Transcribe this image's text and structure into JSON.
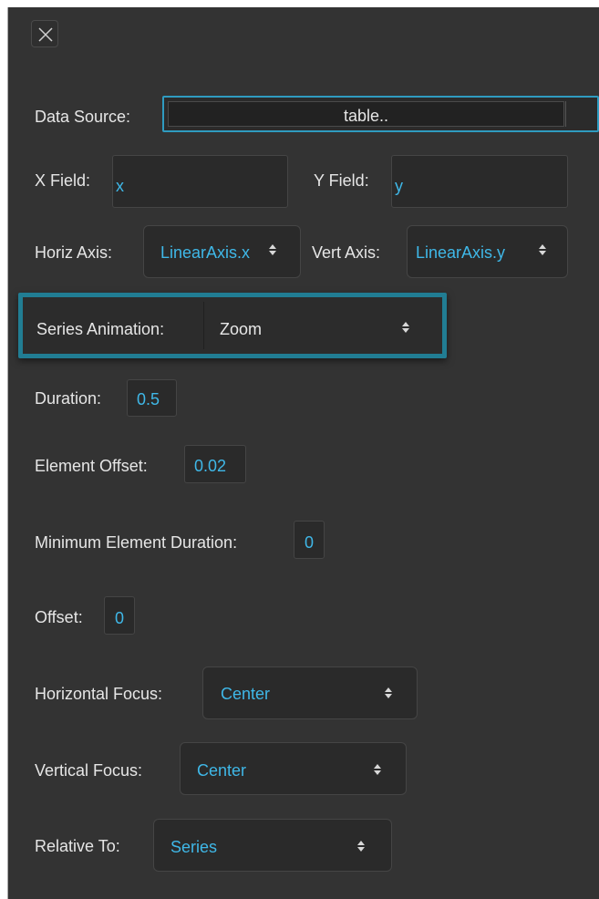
{
  "close_button": {
    "icon": "close-icon"
  },
  "data_source": {
    "label": "Data Source:",
    "value": "table.."
  },
  "x_field": {
    "label": "X Field:",
    "value": "x"
  },
  "y_field": {
    "label": "Y Field:",
    "value": "y"
  },
  "horiz_axis": {
    "label": "Horiz Axis:",
    "value": "LinearAxis.x"
  },
  "vert_axis": {
    "label": "Vert Axis:",
    "value": "LinearAxis.y"
  },
  "series_animation": {
    "label": "Series Animation:",
    "value": "Zoom"
  },
  "duration": {
    "label": "Duration:",
    "value": "0.5"
  },
  "element_offset": {
    "label": "Element Offset:",
    "value": "0.02"
  },
  "min_element_duration": {
    "label": "Minimum Element Duration:",
    "value": "0"
  },
  "offset": {
    "label": "Offset:",
    "value": "0"
  },
  "horizontal_focus": {
    "label": "Horizontal Focus:",
    "value": "Center"
  },
  "vertical_focus": {
    "label": "Vertical Focus:",
    "value": "Center"
  },
  "relative_to": {
    "label": "Relative To:",
    "value": "Series"
  },
  "colors": {
    "panel_bg": "#333333",
    "accent": "#3fb8e8",
    "highlight": "#217d93"
  }
}
